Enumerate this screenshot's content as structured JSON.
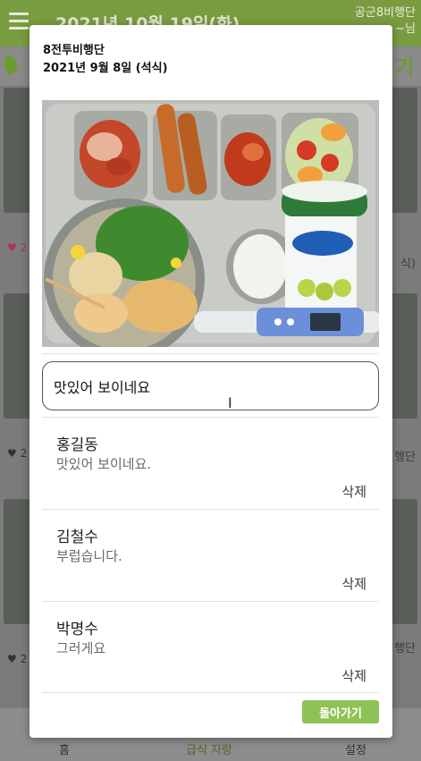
{
  "background": {
    "header_date": "2021년 10월 19일(화)",
    "unit_line1": "공군8비행단",
    "unit_line2": "~님",
    "side_right_labels": [
      "행단",
      "식)",
      "행단"
    ],
    "side_left_counts": [
      "2",
      "2",
      "2"
    ],
    "bottom_tabs": [
      "홈",
      "급식 자랑",
      "설정"
    ],
    "active_tab": "급식 자랑"
  },
  "modal": {
    "unit": "8전투비행단",
    "date": "2021년 9월 8일 (석식)",
    "comment_input_value": "맛있어 보이네요",
    "comments": [
      {
        "name": "홍길동",
        "text": "맛있어 보이네요.",
        "delete_label": "삭제"
      },
      {
        "name": "김철수",
        "text": "부럽습니다.",
        "delete_label": "삭제"
      },
      {
        "name": "박명수",
        "text": "그러게요",
        "delete_label": "삭제"
      }
    ],
    "back_label": "돌아가기"
  },
  "colors": {
    "accent": "#8fc256",
    "header": "#7a9c40"
  }
}
